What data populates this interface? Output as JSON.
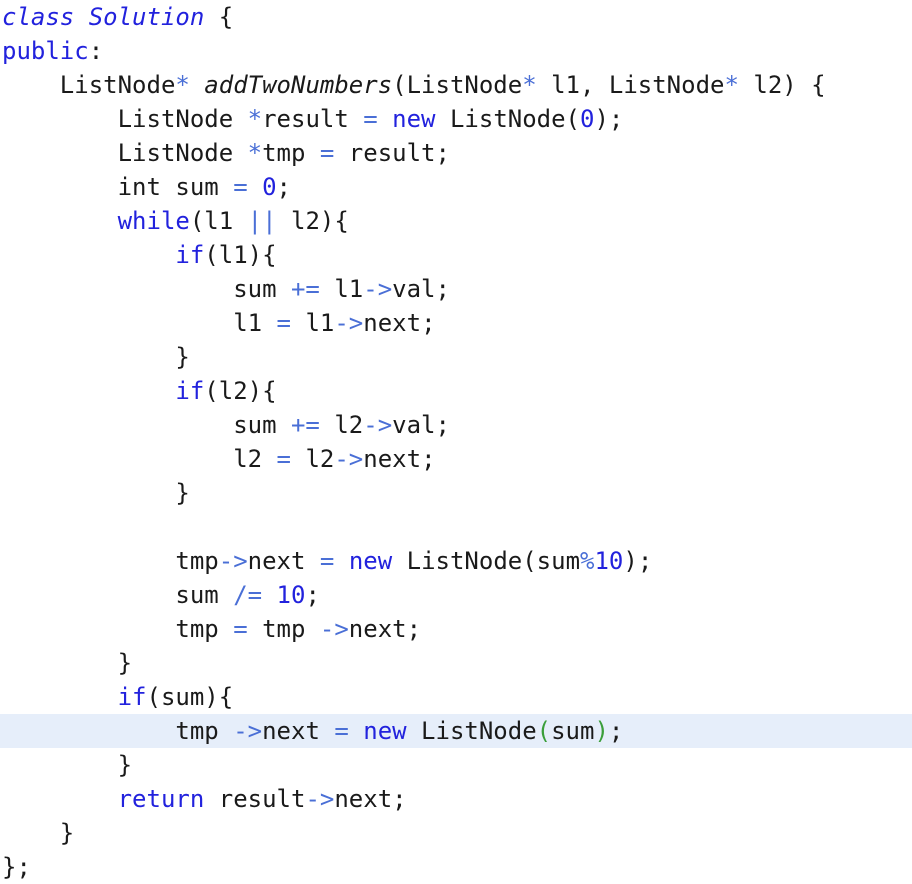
{
  "editor": {
    "language": "cpp",
    "background_color": "#ffffff",
    "highlight_color": "#e6eefa",
    "keyword_color": "#2222dd",
    "operator_color": "#4a6fd6",
    "text_color": "#1a1a1a",
    "matching_bracket_color": "#3a9e3a",
    "highlighted_line_number": 21,
    "full_text": "class Solution {\npublic:\n    ListNode* addTwoNumbers(ListNode* l1, ListNode* l2) {\n        ListNode *result = new ListNode(0);\n        ListNode *tmp = result;\n        int sum = 0;\n        while(l1 || l2){\n            if(l1){\n                sum += l1->val;\n                l1 = l1->next;\n            }\n            if(l2){\n                sum += l2->val;\n                l2 = l2->next;\n            }\n\n            tmp->next = new ListNode(sum%10);\n            sum /= 10;\n            tmp = tmp ->next;\n        }\n        if(sum){\n            tmp ->next = new ListNode(sum);\n        }\n        return result->next;\n    }\n};"
  },
  "lines": [
    {
      "n": 1,
      "highlighted": false,
      "tokens": [
        {
          "t": "class",
          "c": "kw-it"
        },
        {
          "t": " ",
          "c": "plain"
        },
        {
          "t": "Solution",
          "c": "kw-it"
        },
        {
          "t": " {",
          "c": "punct"
        }
      ]
    },
    {
      "n": 2,
      "highlighted": false,
      "tokens": [
        {
          "t": "public",
          "c": "kw"
        },
        {
          "t": ":",
          "c": "punct"
        }
      ]
    },
    {
      "n": 3,
      "highlighted": false,
      "tokens": [
        {
          "t": "    ListNode",
          "c": "type"
        },
        {
          "t": "*",
          "c": "op"
        },
        {
          "t": " ",
          "c": "plain"
        },
        {
          "t": "addTwoNumbers",
          "c": "fn"
        },
        {
          "t": "(ListNode",
          "c": "plain"
        },
        {
          "t": "*",
          "c": "op"
        },
        {
          "t": " l1, ListNode",
          "c": "plain"
        },
        {
          "t": "*",
          "c": "op"
        },
        {
          "t": " l2) {",
          "c": "plain"
        }
      ]
    },
    {
      "n": 4,
      "highlighted": false,
      "tokens": [
        {
          "t": "        ListNode ",
          "c": "plain"
        },
        {
          "t": "*",
          "c": "op"
        },
        {
          "t": "result ",
          "c": "plain"
        },
        {
          "t": "=",
          "c": "op"
        },
        {
          "t": " ",
          "c": "plain"
        },
        {
          "t": "new",
          "c": "kw"
        },
        {
          "t": " ListNode(",
          "c": "plain"
        },
        {
          "t": "0",
          "c": "num"
        },
        {
          "t": ");",
          "c": "plain"
        }
      ]
    },
    {
      "n": 5,
      "highlighted": false,
      "tokens": [
        {
          "t": "        ListNode ",
          "c": "plain"
        },
        {
          "t": "*",
          "c": "op"
        },
        {
          "t": "tmp ",
          "c": "plain"
        },
        {
          "t": "=",
          "c": "op"
        },
        {
          "t": " result;",
          "c": "plain"
        }
      ]
    },
    {
      "n": 6,
      "highlighted": false,
      "tokens": [
        {
          "t": "        int sum ",
          "c": "plain"
        },
        {
          "t": "=",
          "c": "op"
        },
        {
          "t": " ",
          "c": "plain"
        },
        {
          "t": "0",
          "c": "num"
        },
        {
          "t": ";",
          "c": "plain"
        }
      ]
    },
    {
      "n": 7,
      "highlighted": false,
      "tokens": [
        {
          "t": "        ",
          "c": "plain"
        },
        {
          "t": "while",
          "c": "kw"
        },
        {
          "t": "(l1 ",
          "c": "plain"
        },
        {
          "t": "||",
          "c": "op"
        },
        {
          "t": " l2){",
          "c": "plain"
        }
      ]
    },
    {
      "n": 8,
      "highlighted": false,
      "tokens": [
        {
          "t": "            ",
          "c": "plain"
        },
        {
          "t": "if",
          "c": "kw"
        },
        {
          "t": "(l1){",
          "c": "plain"
        }
      ]
    },
    {
      "n": 9,
      "highlighted": false,
      "tokens": [
        {
          "t": "                sum ",
          "c": "plain"
        },
        {
          "t": "+=",
          "c": "op"
        },
        {
          "t": " l1",
          "c": "plain"
        },
        {
          "t": "->",
          "c": "op"
        },
        {
          "t": "val;",
          "c": "plain"
        }
      ]
    },
    {
      "n": 10,
      "highlighted": false,
      "tokens": [
        {
          "t": "                l1 ",
          "c": "plain"
        },
        {
          "t": "=",
          "c": "op"
        },
        {
          "t": " l1",
          "c": "plain"
        },
        {
          "t": "->",
          "c": "op"
        },
        {
          "t": "next;",
          "c": "plain"
        }
      ]
    },
    {
      "n": 11,
      "highlighted": false,
      "tokens": [
        {
          "t": "            }",
          "c": "plain"
        }
      ]
    },
    {
      "n": 12,
      "highlighted": false,
      "tokens": [
        {
          "t": "            ",
          "c": "plain"
        },
        {
          "t": "if",
          "c": "kw"
        },
        {
          "t": "(l2){",
          "c": "plain"
        }
      ]
    },
    {
      "n": 13,
      "highlighted": false,
      "tokens": [
        {
          "t": "                sum ",
          "c": "plain"
        },
        {
          "t": "+=",
          "c": "op"
        },
        {
          "t": " l2",
          "c": "plain"
        },
        {
          "t": "->",
          "c": "op"
        },
        {
          "t": "val;",
          "c": "plain"
        }
      ]
    },
    {
      "n": 14,
      "highlighted": false,
      "tokens": [
        {
          "t": "                l2 ",
          "c": "plain"
        },
        {
          "t": "=",
          "c": "op"
        },
        {
          "t": " l2",
          "c": "plain"
        },
        {
          "t": "->",
          "c": "op"
        },
        {
          "t": "next;",
          "c": "plain"
        }
      ]
    },
    {
      "n": 15,
      "highlighted": false,
      "tokens": [
        {
          "t": "            }",
          "c": "plain"
        }
      ]
    },
    {
      "n": 16,
      "highlighted": false,
      "tokens": [
        {
          "t": "",
          "c": "plain"
        }
      ]
    },
    {
      "n": 17,
      "highlighted": false,
      "tokens": [
        {
          "t": "            tmp",
          "c": "plain"
        },
        {
          "t": "->",
          "c": "op"
        },
        {
          "t": "next ",
          "c": "plain"
        },
        {
          "t": "=",
          "c": "op"
        },
        {
          "t": " ",
          "c": "plain"
        },
        {
          "t": "new",
          "c": "kw"
        },
        {
          "t": " ListNode(sum",
          "c": "plain"
        },
        {
          "t": "%",
          "c": "op"
        },
        {
          "t": "10",
          "c": "num"
        },
        {
          "t": ");",
          "c": "plain"
        }
      ]
    },
    {
      "n": 18,
      "highlighted": false,
      "tokens": [
        {
          "t": "            sum ",
          "c": "plain"
        },
        {
          "t": "/=",
          "c": "op"
        },
        {
          "t": " ",
          "c": "plain"
        },
        {
          "t": "10",
          "c": "num"
        },
        {
          "t": ";",
          "c": "plain"
        }
      ]
    },
    {
      "n": 19,
      "highlighted": false,
      "tokens": [
        {
          "t": "            tmp ",
          "c": "plain"
        },
        {
          "t": "=",
          "c": "op"
        },
        {
          "t": " tmp ",
          "c": "plain"
        },
        {
          "t": "->",
          "c": "op"
        },
        {
          "t": "next;",
          "c": "plain"
        }
      ]
    },
    {
      "n": 20,
      "highlighted": false,
      "tokens": [
        {
          "t": "        }",
          "c": "plain"
        }
      ]
    },
    {
      "n": 21,
      "highlighted": false,
      "tokens": [
        {
          "t": "        ",
          "c": "plain"
        },
        {
          "t": "if",
          "c": "kw"
        },
        {
          "t": "(sum){",
          "c": "plain"
        }
      ]
    },
    {
      "n": 22,
      "highlighted": true,
      "tokens": [
        {
          "t": "            tmp ",
          "c": "plain"
        },
        {
          "t": "->",
          "c": "op"
        },
        {
          "t": "next ",
          "c": "plain"
        },
        {
          "t": "=",
          "c": "op"
        },
        {
          "t": " ",
          "c": "plain"
        },
        {
          "t": "new",
          "c": "kw"
        },
        {
          "t": " ListNode",
          "c": "plain"
        },
        {
          "t": "(",
          "c": "bracket-match"
        },
        {
          "t": "sum",
          "c": "plain"
        },
        {
          "t": ")",
          "c": "bracket-match"
        },
        {
          "t": ";",
          "c": "plain"
        }
      ]
    },
    {
      "n": 23,
      "highlighted": false,
      "tokens": [
        {
          "t": "        }",
          "c": "plain"
        }
      ]
    },
    {
      "n": 24,
      "highlighted": false,
      "tokens": [
        {
          "t": "        ",
          "c": "plain"
        },
        {
          "t": "return",
          "c": "kw"
        },
        {
          "t": " result",
          "c": "plain"
        },
        {
          "t": "->",
          "c": "op"
        },
        {
          "t": "next;",
          "c": "plain"
        }
      ]
    },
    {
      "n": 25,
      "highlighted": false,
      "tokens": [
        {
          "t": "    }",
          "c": "plain"
        }
      ]
    },
    {
      "n": 26,
      "highlighted": false,
      "tokens": [
        {
          "t": "};",
          "c": "plain"
        }
      ]
    }
  ]
}
